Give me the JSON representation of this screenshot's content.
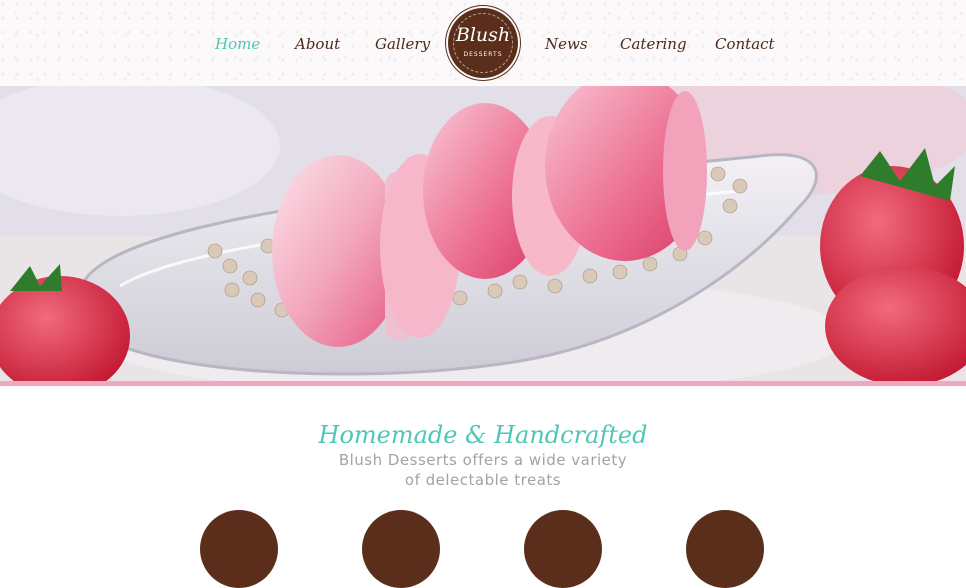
{
  "nav": {
    "items": [
      {
        "label": "Home",
        "active": true
      },
      {
        "label": "About"
      },
      {
        "label": "Gallery"
      },
      {
        "label": "News"
      },
      {
        "label": "Catering"
      },
      {
        "label": "Contact"
      }
    ]
  },
  "logo": {
    "name": "Blush",
    "subtitle": "DESSERTS",
    "color": "#5a2e1a"
  },
  "hero": {
    "image_description_icon": "macarons-hero-image",
    "accent_bar_color": "#f1a6c4"
  },
  "intro": {
    "title": "Homemade & Handcrafted",
    "line1": "Blush Desserts offers a wide variety",
    "line2": "of delectable treats"
  },
  "colors": {
    "accent": "#4fc7b6",
    "brown": "#5a2e1a",
    "text_grey": "#a3a3a3"
  }
}
